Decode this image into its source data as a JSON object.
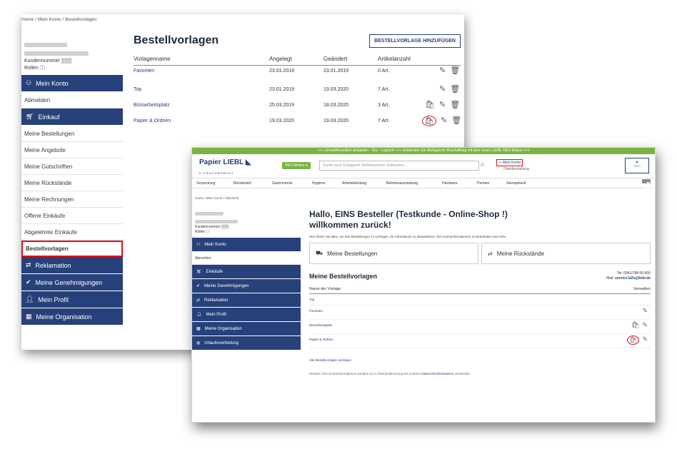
{
  "shot1": {
    "breadcrumb": [
      "Home",
      "Mein Konto",
      "Bestellvorlagen"
    ],
    "sidebar": {
      "kundennummer_label": "Kundennummer",
      "rollen_label": "Rollen",
      "mein_konto": "Mein Konto",
      "abmelden": "Abmelden",
      "einkauf": "Einkauf",
      "links": [
        "Meine Bestellungen",
        "Meine Angebote",
        "Meine Gutschriften",
        "Meine Rückstände",
        "Meine Rechnungen",
        "Offene Einkäufe",
        "Abgelehnte Einkäufe",
        "Bestellvorlagen"
      ],
      "bottom": [
        "Reklamation",
        "Meine Genehmigungen",
        "Mein Profil",
        "Meine Organisation"
      ]
    },
    "title": "Bestellvorlagen",
    "add_button": "BESTELLVORLAGE HINZUFÜGEN",
    "columns": [
      "Vorlagenname",
      "Angelegt",
      "Geändert",
      "Artikelanzahl"
    ],
    "rows": [
      {
        "name": "Favoriten",
        "created": "23.01.2019",
        "changed": "23.01.2019",
        "count": "0 Art."
      },
      {
        "name": "Top",
        "created": "23.01.2019",
        "changed": "19.03.2020",
        "count": "7 Art."
      },
      {
        "name": "Büroarbeitsplatz",
        "created": "25.03.2019",
        "changed": "18.03.2020",
        "count": "3 Art."
      },
      {
        "name": "Papier & Ordnen",
        "created": "19.03.2020",
        "changed": "19.03.2020",
        "count": "7 Art."
      }
    ]
  },
  "shot2": {
    "banner": "+++ Umweltfreundlich einkaufen - Öko - Logisch! +++ Entdecken Sie ökologische Beschaffung mit dem neuen LIEBL ÖKO Modus +++",
    "logo": "Papier LIEBL",
    "logo_sub": "E-PROCUREMENT",
    "oeko": "ÖKO Modus",
    "search_placeholder": "Suche nach Schlagwort, Artikelnummer, Kategorien ...",
    "mein_konto": "Mein Konto",
    "direktbestellung": "Direktbestellung",
    "nav": [
      "Verpackung",
      "Bürobedarf",
      "Gastronomie",
      "Hygiene",
      "Arbeitskleidung",
      "Betriebsausstattung",
      "Hardware",
      "Themen",
      "Stempelwelt"
    ],
    "cart": "1 ARTIKEL",
    "breadcrumb": "Home / Mein Konto / Übersicht",
    "sidebar": {
      "kundennummer_label": "Kundennummer",
      "rollen_label": "Rollen",
      "mein_konto": "Mein Konto",
      "abmelden": "Abmelden",
      "items": [
        "Einkäufe",
        "Meine Genehmigungen",
        "Reklamation",
        "Mein Profil",
        "Meine Organisation",
        "Urlaubsvertretung"
      ]
    },
    "hello": "Hallo, EINS Besteller (Testkunde - Online-Shop !)",
    "welcome": "willkommen zurück!",
    "intro": "Hier finden Sie alles, um Ihre Bestellungen zu verfolgen, Ihr Adressbuch zu aktualisieren, Ihre Kontoinformationen zu bearbeiten und mehr.",
    "tiles": [
      "Meine Bestellungen",
      "Meine Rückstände"
    ],
    "vorlagen_title": "Meine Bestellvorlagen",
    "tel": "Tel: 0941/788 60-900",
    "mail_label": "Mail:",
    "mail": "service-b2b@liebl.de",
    "thead": [
      "Name der Vorlage",
      "Verwalten"
    ],
    "rows": [
      "Top",
      "Favoriten",
      "Büroarbeitsplatz",
      "Papier & Ordnen"
    ],
    "all_link": "Alle Bestellvorlagen anzeigen",
    "hint_prefix": "Hinweis: Ihre Kontoinformationen werden nur in Übereinstimmung mit unseren",
    "hint_link": "Datenschutzhinweisen",
    "hint_suffix": "verwendet."
  }
}
